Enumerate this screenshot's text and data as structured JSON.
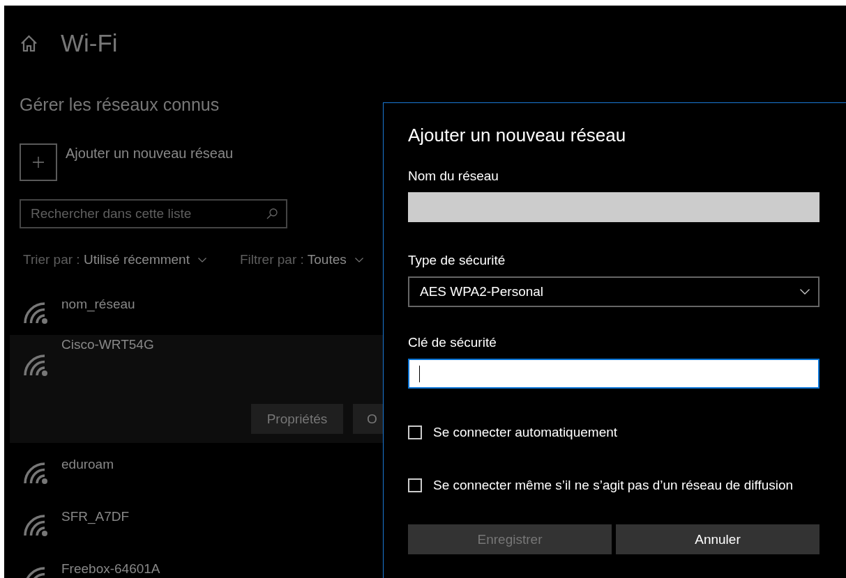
{
  "page": {
    "title": "Wi-Fi"
  },
  "known_networks": {
    "heading": "Gérer les réseaux connus",
    "add_label": "Ajouter un nouveau réseau",
    "search": {
      "placeholder": "Rechercher dans cette liste"
    },
    "sort": {
      "label": "Trier par :",
      "value": "Utilisé récemment"
    },
    "filter": {
      "label": "Filtrer par :",
      "value": "Toutes"
    },
    "networks": [
      {
        "name": "nom_réseau",
        "selected": false
      },
      {
        "name": "Cisco-WRT54G",
        "selected": true,
        "actions": [
          "Propriétés",
          "O"
        ]
      },
      {
        "name": "eduroam",
        "selected": false
      },
      {
        "name": "SFR_A7DF",
        "selected": false
      },
      {
        "name": "Freebox-64601A",
        "selected": false
      }
    ]
  },
  "dialog": {
    "title": "Ajouter un nouveau réseau",
    "fields": [
      {
        "kind": "text",
        "label": "Nom du réseau",
        "focused": false
      },
      {
        "kind": "select",
        "label": "Type de sécurité",
        "value": "AES WPA2-Personal"
      },
      {
        "kind": "text",
        "label": "Clé de sécurité",
        "focused": true
      }
    ],
    "checkboxes": [
      {
        "label": "Se connecter automatiquement",
        "checked": false
      },
      {
        "label": "Se connecter même s’il ne s’agit pas d’un réseau de diffusion",
        "checked": false
      }
    ],
    "buttons": [
      {
        "label": "Enregistrer",
        "disabled": true
      },
      {
        "label": "Annuler",
        "disabled": false
      }
    ]
  }
}
